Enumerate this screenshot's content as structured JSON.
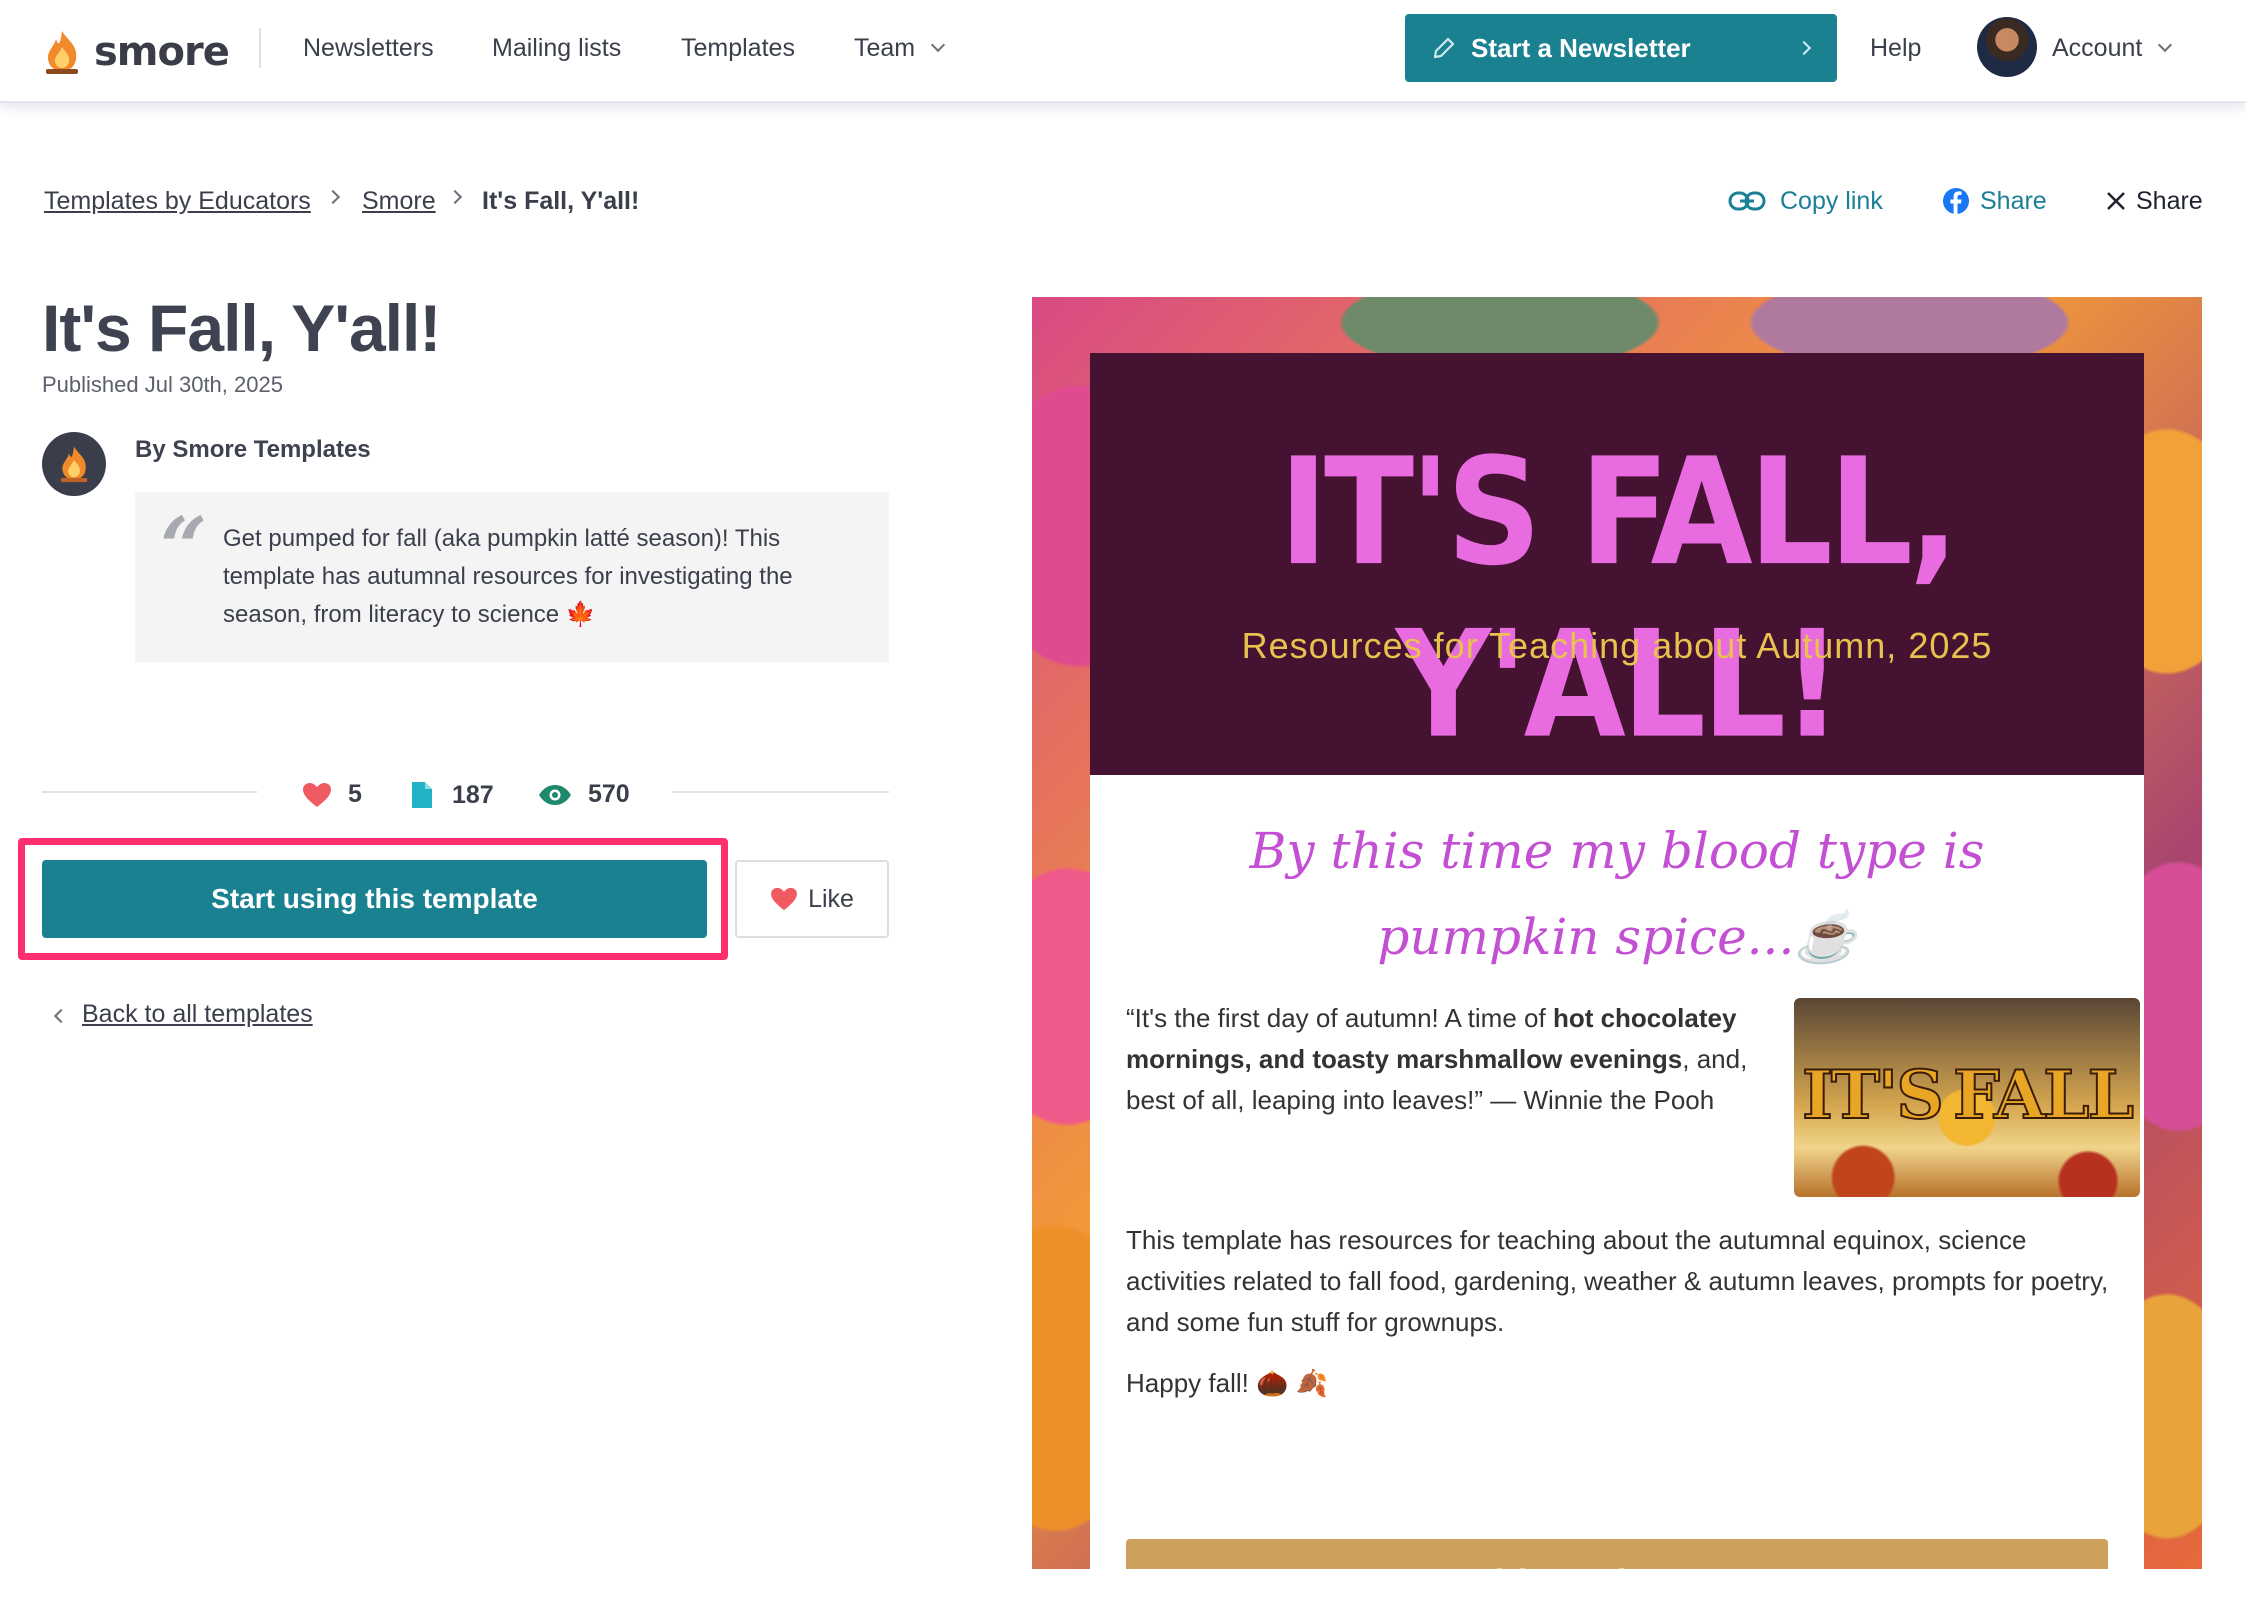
{
  "nav": {
    "logo_text": "smore",
    "links": [
      "Newsletters",
      "Mailing lists",
      "Templates",
      "Team"
    ],
    "start_button": "Start a Newsletter",
    "help": "Help",
    "account": "Account"
  },
  "breadcrumb": {
    "items": [
      "Templates by Educators",
      "Smore"
    ],
    "current": "It's Fall, Y'all!"
  },
  "share": {
    "copy_link": "Copy link",
    "facebook": "Share",
    "x": "Share"
  },
  "template": {
    "title": "It's Fall, Y'all!",
    "published": "Published Jul 30th, 2025",
    "author": "By Smore Templates",
    "description": "Get pumped for fall (aka pumpkin latté season)! This template has autumnal resources for investigating the season, from literacy to science 🍁",
    "stats": {
      "likes": "5",
      "copies": "187",
      "views": "570"
    },
    "use_button": "Start using this template",
    "like_button": "Like",
    "back_link": "Back to all templates"
  },
  "newsletter": {
    "title": "IT'S FALL, Y'ALL!",
    "subtitle": "Resources for Teaching about Autumn, 2025",
    "quote": "By this time my blood type is pumpkin spice...☕",
    "intro_a": "“It's the first day of autumn! A time of ",
    "intro_bold": "hot chocolatey mornings, and toasty marshmallow evenings",
    "intro_b": ", and, best of all, leaping into leaves!” — Winnie the Pooh",
    "body": "This template has resources for teaching about the autumnal equinox, science activities related to fall food, gardening, weather & autumn leaves, prompts for poetry, and some fun stuff for grownups.",
    "happy": "Happy fall! 🌰 🍂",
    "image_text_left": "IT'S",
    "image_text_right": "FALL",
    "did_you_know": "Did you know...?"
  },
  "colors": {
    "teal": "#1a8190",
    "highlight": "#ff2e6e",
    "nl_header": "#451232",
    "nl_title": "#e86be0",
    "nl_subtitle": "#e8c24d",
    "nl_quote": "#c34fd3",
    "did_you_know_bg": "#cda05c"
  },
  "icons": {
    "logo": "flame-icon",
    "edit": "pencil-icon",
    "link": "link-icon",
    "facebook": "facebook-icon",
    "x": "x-logo-icon",
    "heart": "heart-icon",
    "document": "document-icon",
    "eye": "eye-icon"
  }
}
